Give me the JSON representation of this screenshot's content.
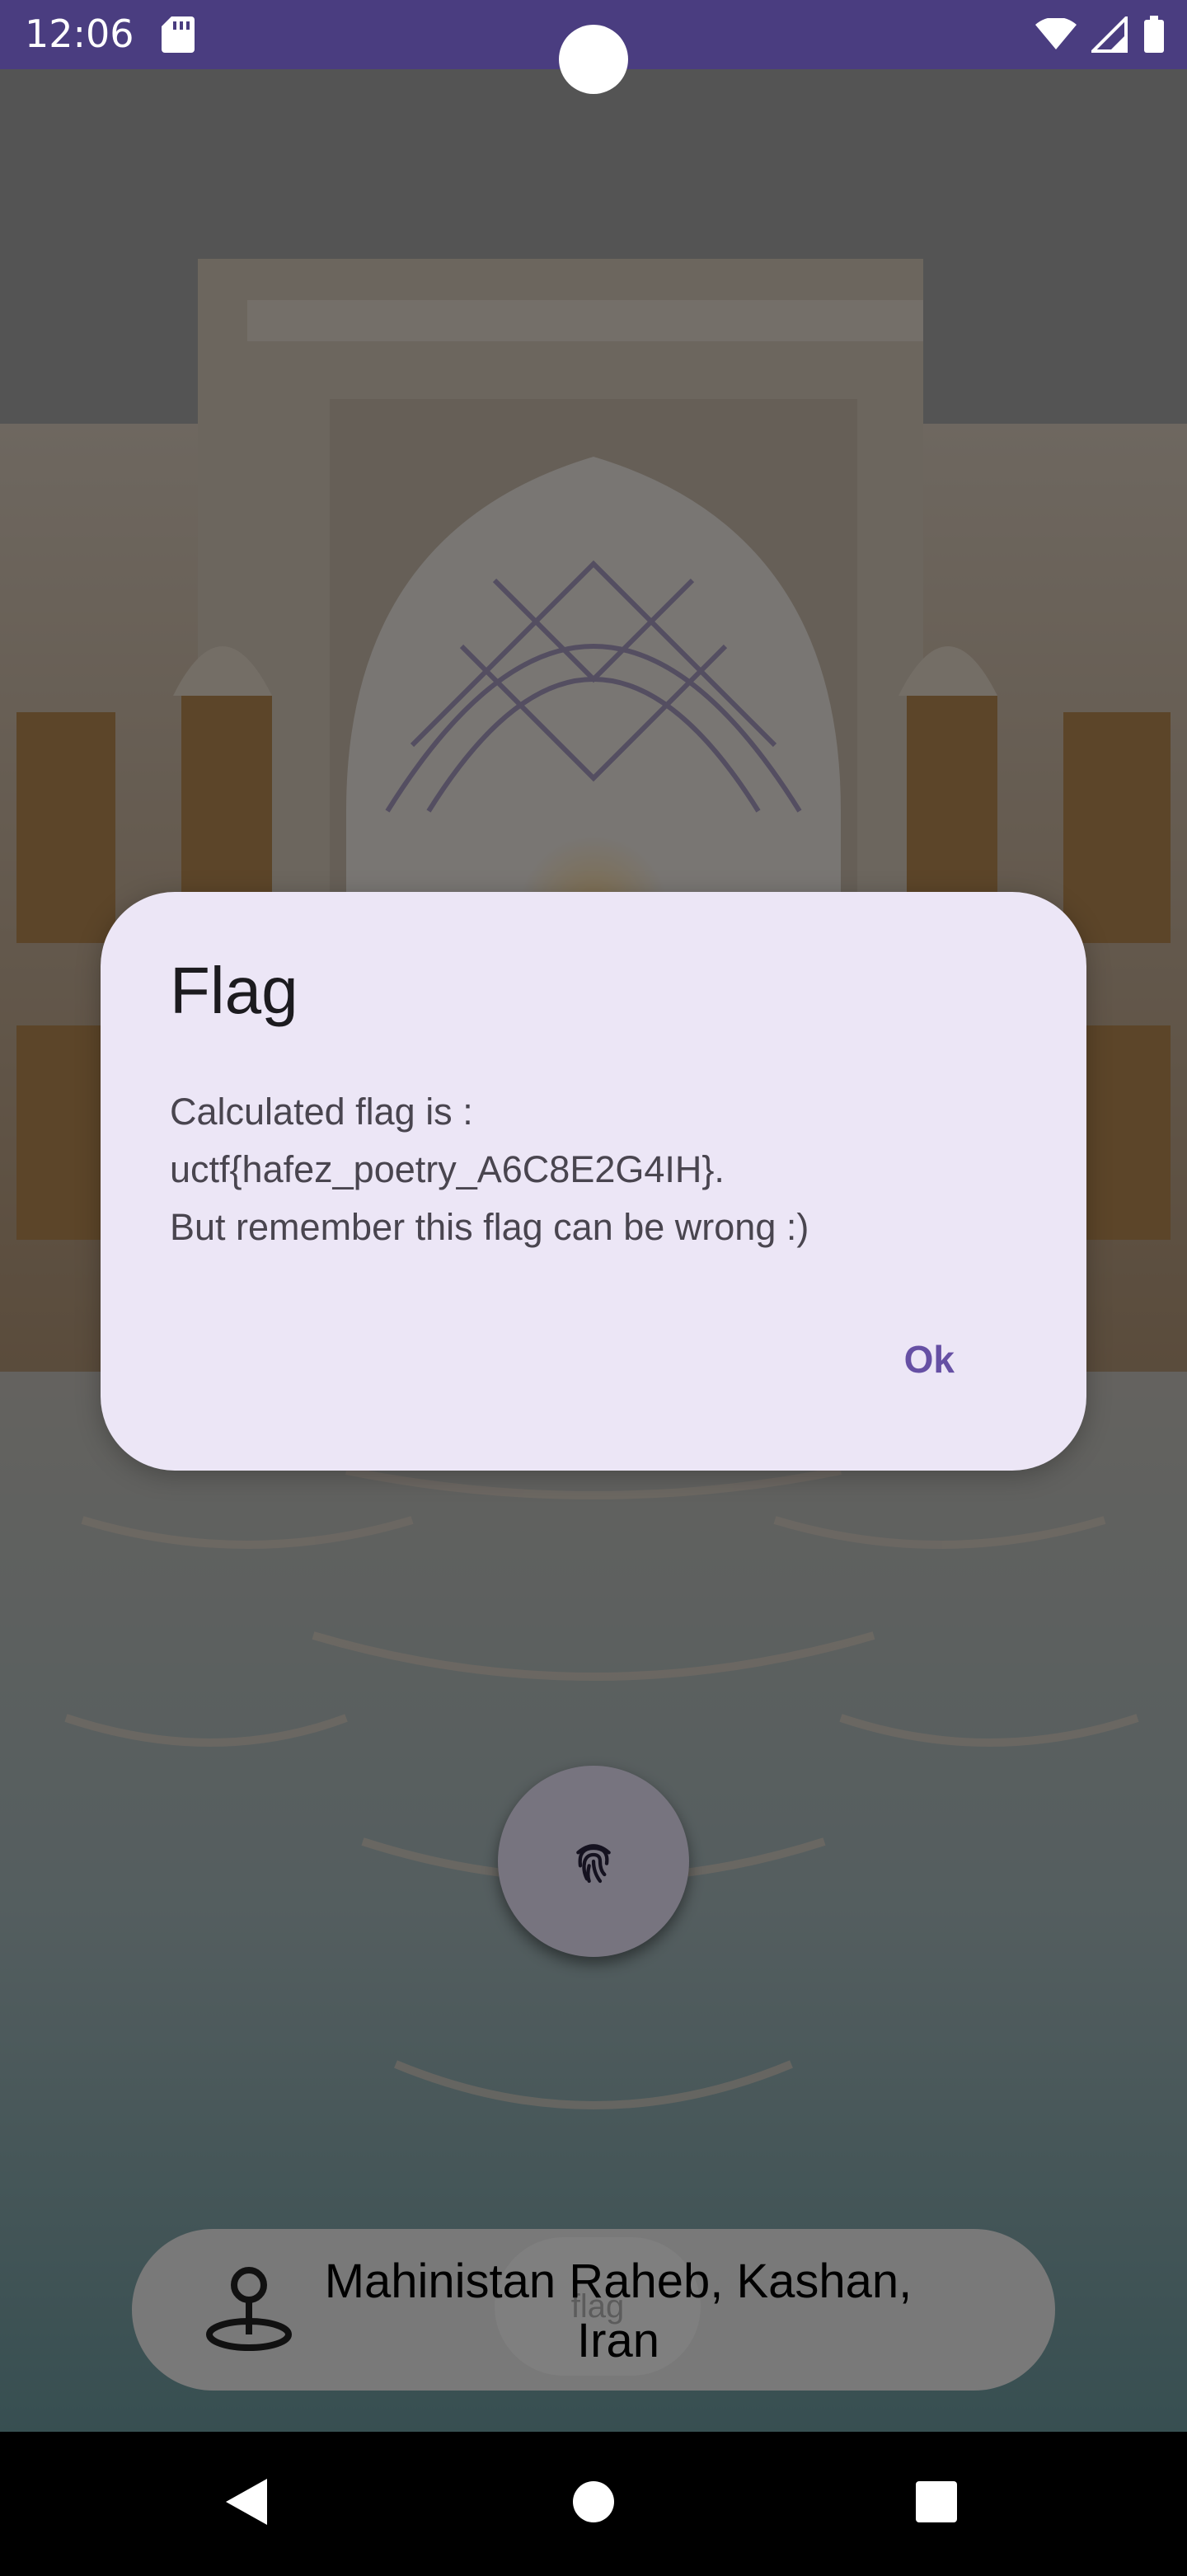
{
  "status_bar": {
    "time": "12:06",
    "icons": [
      "sd-card-icon",
      "wifi-icon",
      "signal-icon",
      "battery-icon"
    ]
  },
  "dialog": {
    "title": "Flag",
    "message_lines": [
      "Calculated flag is :",
      "uctf{hafez_poetry_A6C8E2G4IH}.",
      "But remember this flag can be wrong :)"
    ],
    "ok_label": "Ok"
  },
  "main": {
    "fab_icon": "fingerprint-icon",
    "flag_button_label": "flag",
    "location_icon": "location-pin-icon",
    "location_line1": "Mahinistan Raheb, Kashan,",
    "location_line2": "Iran"
  },
  "nav_bar": {
    "icons": [
      "back-icon",
      "home-icon",
      "recents-icon"
    ]
  },
  "colors": {
    "status_bar": "#4a3d80",
    "dialog_bg": "#ece6f6",
    "accent": "#6650a4",
    "fab_bg": "#efe8ff"
  }
}
